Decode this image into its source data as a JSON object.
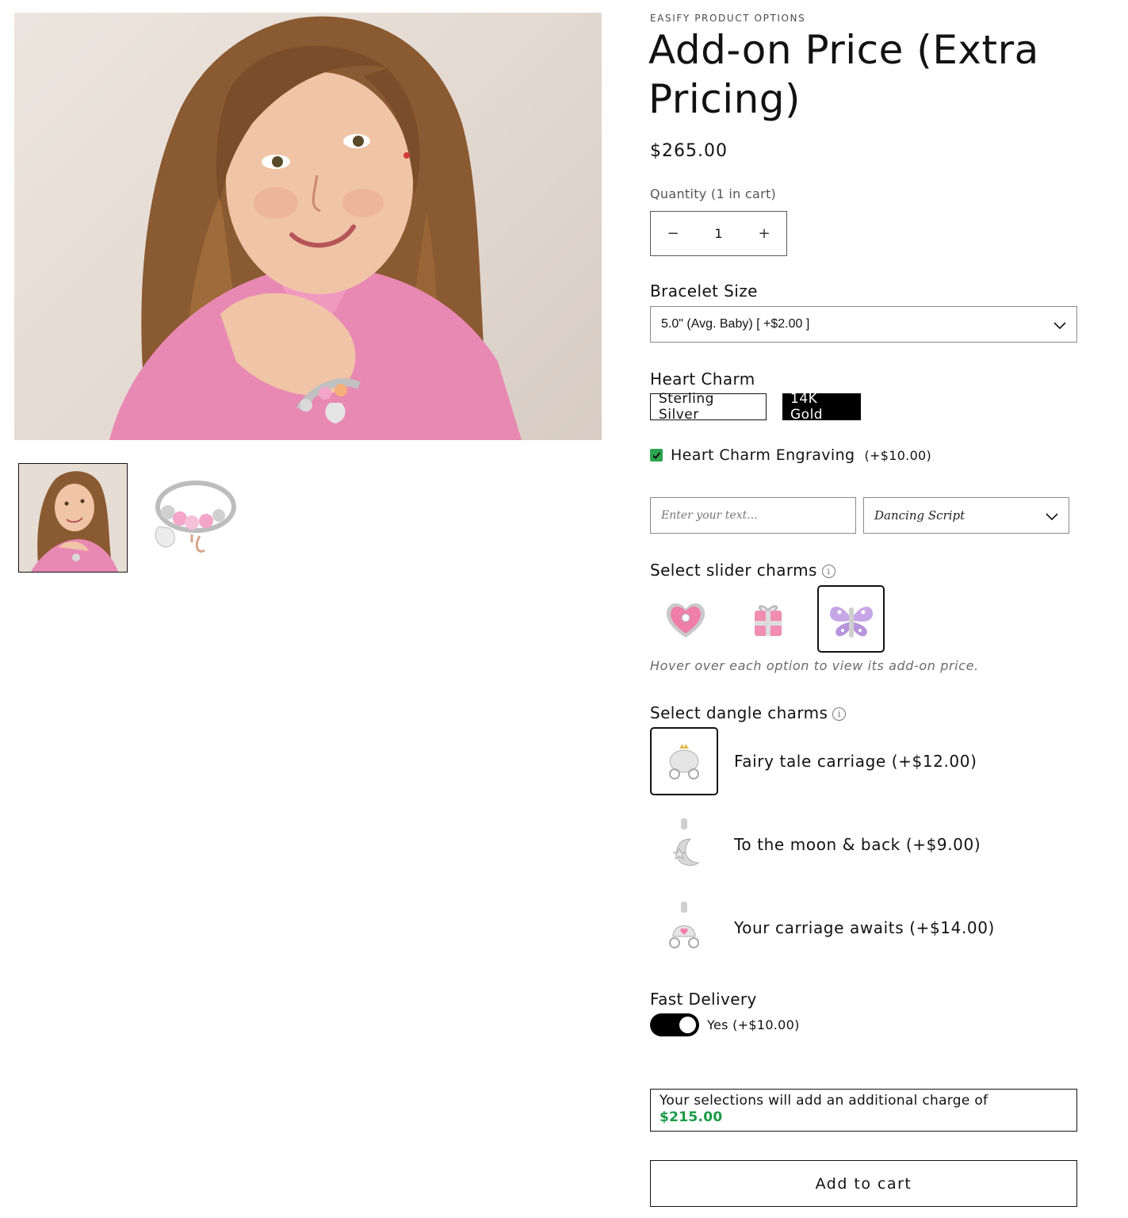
{
  "product": {
    "vendor": "EASIFY PRODUCT OPTIONS",
    "title": "Add-on Price (Extra Pricing)",
    "price": "$265.00"
  },
  "quantity": {
    "label": "Quantity (1 in cart)",
    "value": "1",
    "decrement": "−",
    "increment": "+"
  },
  "bracelet_size": {
    "label": "Bracelet Size",
    "selected": "5.0\" (Avg. Baby) [ +$2.00 ]"
  },
  "heart_charm": {
    "label": "Heart Charm",
    "options": [
      {
        "label": "Sterling Silver",
        "selected": false
      },
      {
        "label": "14K Gold",
        "selected": true
      }
    ]
  },
  "engraving": {
    "label": "Heart Charm Engraving",
    "price": "(+$10.00)",
    "checked": true,
    "text_placeholder": "Enter your text...",
    "font_selected": "Dancing Script"
  },
  "slider_charms": {
    "label": "Select slider charms",
    "options": [
      "heart-charm",
      "gift-box-charm",
      "butterfly-charm"
    ],
    "selected_index": 2,
    "hint": "Hover over each option to view its add-on price."
  },
  "dangle_charms": {
    "label": "Select dangle charms",
    "items": [
      {
        "label": "Fairy tale carriage (+$12.00)",
        "selected": true
      },
      {
        "label": "To the moon & back (+$9.00)",
        "selected": false
      },
      {
        "label": "Your carriage awaits (+$14.00)",
        "selected": false
      }
    ]
  },
  "fast_delivery": {
    "label": "Fast Delivery",
    "toggle_label": "Yes (+$10.00)",
    "on": true
  },
  "summary": {
    "text": "Your selections will add an additional charge of",
    "amount": "$215.00"
  },
  "add_to_cart": "Add to cart",
  "colors": {
    "accent_green": "#1a9a45",
    "checkbox_green": "#2ea44f",
    "selected_black": "#000000"
  }
}
